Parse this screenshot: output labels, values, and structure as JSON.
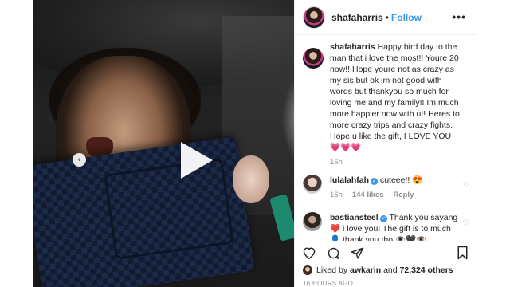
{
  "header": {
    "username": "shafaharris",
    "separator": "•",
    "follow_label": "Follow",
    "more_label": "•••"
  },
  "caption": {
    "username": "shafaharris",
    "text": "Happy bird day to the man that i love the most!! Youre 20 now!! Hope youre not as crazy as my sis but ok im not good with words but thankyou so much for loving me and my family!! Im much more happier now with u!! Heres to more crazy trips and crazy fights. Hope u like the gift, I LOVE YOU💗💗💗",
    "time": "16h"
  },
  "comments": [
    {
      "username": "lulalahfah",
      "verified": true,
      "text": "cuteee!! 😍",
      "time": "16h",
      "likes": "144 likes",
      "reply": "Reply"
    },
    {
      "username": "bastiansteel",
      "verified": true,
      "text": "Thank you sayang ❤️ i love you! The gift is to much 👤 thank you tho 👁️🖤👁️"
    }
  ],
  "likes": {
    "prefix": "Liked by",
    "user": "awkarin",
    "conjunction": "and",
    "count": "72,324 others"
  },
  "timestamp": "16 HOURS AGO",
  "icons": {
    "prev": "‹",
    "heart_small": "♡"
  },
  "colors": {
    "follow": "#3897f0",
    "verified": "#3897f0",
    "muted": "#8e8e8e"
  }
}
